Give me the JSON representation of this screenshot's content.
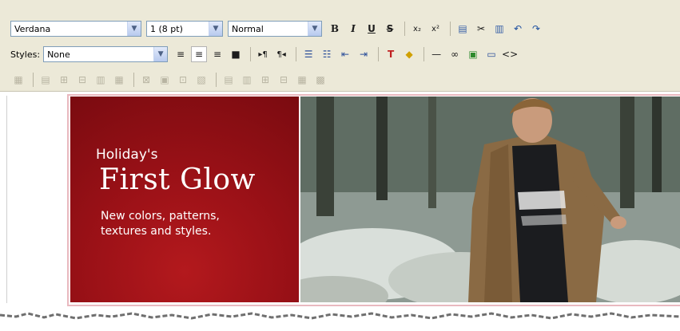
{
  "toolbar": {
    "font_family": "Verdana",
    "font_size": "1 (8 pt)",
    "format": "Normal",
    "styles_label": "Styles:",
    "styles_value": "None"
  },
  "banner": {
    "kicker": "Holiday's",
    "title": "First Glow",
    "subtitle_line1": "New colors, patterns,",
    "subtitle_line2": "textures and styles."
  },
  "colors": {
    "red_panel": "#9b1117",
    "frame_pink": "#e9b9bf",
    "toolbar_bg": "#ece9d8"
  },
  "icons": {
    "row1": [
      "bold-icon",
      "italic-icon",
      "underline-icon",
      "strikethrough-icon",
      "subscript-icon",
      "superscript-icon",
      "paste-icon",
      "cut-icon",
      "paste-special-icon",
      "undo-icon",
      "redo-icon"
    ],
    "row2": [
      "align-left-icon",
      "align-center-icon",
      "align-right-icon",
      "justify-icon",
      "ltr-icon",
      "rtl-icon",
      "numbered-list-icon",
      "bulleted-list-icon",
      "outdent-icon",
      "indent-icon",
      "text-color-icon",
      "highlight-color-icon",
      "horizontal-rule-icon",
      "link-icon",
      "image-icon",
      "table-icon",
      "source-code-icon"
    ],
    "row3": [
      "table-properties-icon",
      "insert-row-above-icon",
      "insert-row-below-icon",
      "delete-row-icon",
      "insert-column-left-icon",
      "insert-column-right-icon",
      "delete-column-icon",
      "cell-properties-icon",
      "merge-cells-icon",
      "split-cells-icon"
    ]
  }
}
